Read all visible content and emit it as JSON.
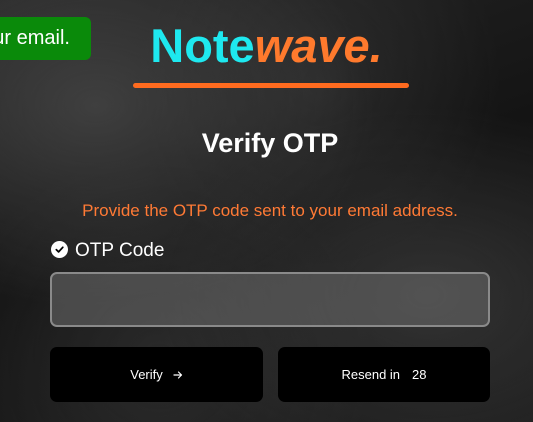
{
  "toast": {
    "message": "ur email."
  },
  "brand": {
    "part1": "Note",
    "part2": "wave."
  },
  "page": {
    "title": "Verify OTP",
    "subtitle": "Provide the OTP code sent to your email address."
  },
  "form": {
    "otp_label": "OTP Code",
    "otp_value": "",
    "otp_placeholder": ""
  },
  "actions": {
    "verify_label": "Verify",
    "resend_label": "Resend in",
    "resend_countdown": "28"
  },
  "colors": {
    "brand_primary": "#1ee8ef",
    "brand_accent": "#ff7a2d",
    "toast_success": "#0a8a0a",
    "subtitle_orange": "#ff7a35",
    "button_bg": "#000000"
  },
  "icons": {
    "label_icon": "check-circle-icon",
    "verify_icon": "arrow-right-icon"
  }
}
